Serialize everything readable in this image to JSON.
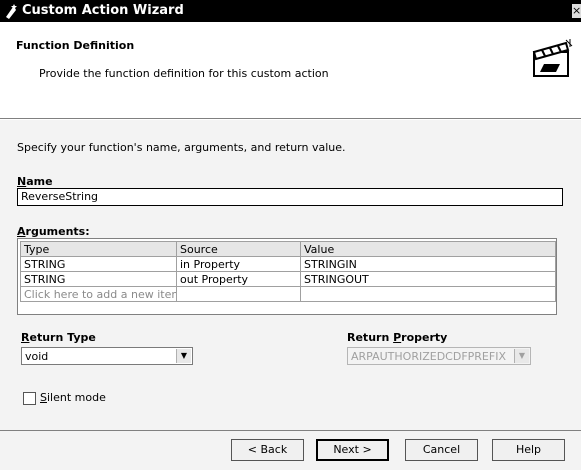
{
  "window": {
    "title": "Custom Action Wizard"
  },
  "header": {
    "title": "Function Definition",
    "subtitle": "Provide the function definition for this custom action"
  },
  "instructions": "Specify your function's name, arguments, and return value.",
  "name": {
    "label_ul": "N",
    "label_rest": "ame",
    "value": "ReverseString"
  },
  "arguments": {
    "label_ul": "A",
    "label_rest": "rguments:",
    "columns": [
      "Type",
      "Source",
      "Value"
    ],
    "rows": [
      [
        "STRING",
        "in Property",
        "STRINGIN"
      ],
      [
        "STRING",
        "out Property",
        "STRINGOUT"
      ]
    ],
    "add_placeholder": "Click here to add a new item"
  },
  "return_type": {
    "label_ul": "R",
    "label_rest": "eturn Type",
    "value": "void"
  },
  "return_property": {
    "label_pre": "Return ",
    "label_ul": "P",
    "label_rest": "roperty",
    "value": "ARPAUTHORIZEDCDFPREFIX"
  },
  "silent_mode": {
    "label_ul": "S",
    "label_rest": "ilent mode",
    "checked": false
  },
  "buttons": {
    "back": "< Back",
    "next": "Next >",
    "cancel": "Cancel",
    "help": "Help"
  },
  "icons": [
    "wizard-app-icon",
    "close-icon",
    "clapperboard-icon",
    "dropdown-arrow-icon"
  ]
}
